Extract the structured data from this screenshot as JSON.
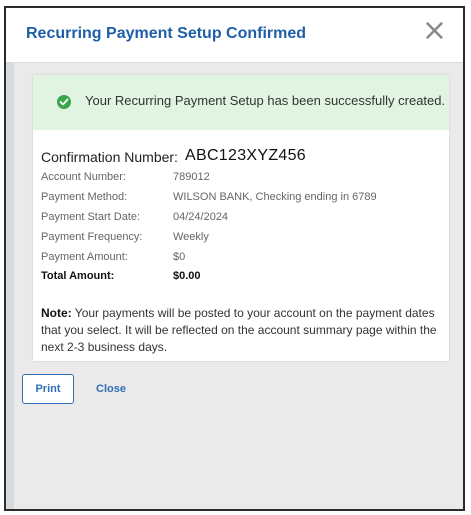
{
  "dialog": {
    "title": "Recurring Payment Setup Confirmed",
    "close_icon": "×"
  },
  "success_message": "Your Recurring Payment Setup has been successfully created.",
  "confirmation": {
    "label": "Confirmation Number:",
    "value": "ABC123XYZ456"
  },
  "details": [
    {
      "label": "Account Number:",
      "value": "789012"
    },
    {
      "label": "Payment Method:",
      "value": "WILSON BANK, Checking ending in 6789"
    },
    {
      "label": "Payment Start Date:",
      "value": "04/24/2024"
    },
    {
      "label": "Payment Frequency:",
      "value": "Weekly"
    },
    {
      "label": "Payment Amount:",
      "value": "$0"
    }
  ],
  "total": {
    "label": "Total Amount:",
    "value": "$0.00"
  },
  "note": {
    "prefix": "Note:",
    "text": " Your payments will be posted to your account on the payment dates that you select. It will be reflected on the account summary page within the next 2-3 business days."
  },
  "actions": {
    "print_label": "Print",
    "close_label": "Close"
  },
  "colors": {
    "title": "#1f5fa8",
    "success_bg": "#e1f4e1",
    "check": "#3aa54a",
    "link": "#2f6fb8"
  }
}
